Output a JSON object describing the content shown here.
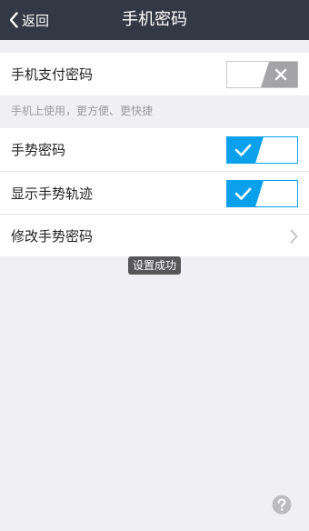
{
  "navbar": {
    "back_label": "返回",
    "title": "手机密码"
  },
  "payment_section": {
    "label": "手机支付密码",
    "enabled": false,
    "hint": "手机上使用，更方便、更快捷"
  },
  "gesture_section": {
    "rows": [
      {
        "label": "手势密码",
        "enabled": true
      },
      {
        "label": "显示手势轨迹",
        "enabled": true
      },
      {
        "label": "修改手势密码"
      }
    ]
  },
  "toast": {
    "message": "设置成功"
  },
  "colors": {
    "navbar": "#323844",
    "toggle_on": "#0aa0ec",
    "toggle_off": "#a4a4a6",
    "background": "#efeff4"
  },
  "icons": {
    "back": "chevron-left-icon",
    "toggle_on": "check-icon",
    "toggle_off": "close-icon",
    "row_arrow": "chevron-right-icon",
    "help": "question-mark-icon"
  }
}
